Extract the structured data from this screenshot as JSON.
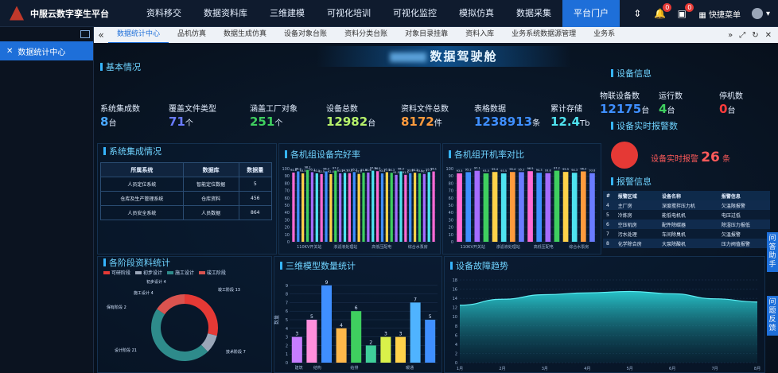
{
  "app": {
    "title": "中服云数字孪生平台"
  },
  "nav": [
    "资料移交",
    "数据资料库",
    "三维建模",
    "可视化培训",
    "可视化监控",
    "模拟仿真",
    "数据采集",
    "平台门户"
  ],
  "nav_active_index": 7,
  "top_right": {
    "badge1": "0",
    "badge2": "0",
    "menu_label": "快捷菜单"
  },
  "sidebar": {
    "items": [
      {
        "label": "数据统计中心"
      }
    ]
  },
  "tabs": [
    "数据统计中心",
    "品机仿真",
    "数据生成仿真",
    "设备对象台账",
    "资料分类台账",
    "对象目录挂靠",
    "资料入库",
    "业务系统数据源管理",
    "业务系"
  ],
  "tabs_active_index": 0,
  "dashboard": {
    "title": "数据驾驶舱",
    "basic_title": "基本情况",
    "basic": [
      {
        "label": "系统集成数",
        "value": "8",
        "unit": "台",
        "color": "#4aa8ff"
      },
      {
        "label": "覆盖文件类型",
        "value": "71",
        "unit": "个",
        "color": "#6a7cff"
      },
      {
        "label": "涵盖工厂对象",
        "value": "251",
        "unit": "个",
        "color": "#3fcf5f"
      },
      {
        "label": "设备总数",
        "value": "12982",
        "unit": "台",
        "color": "#b6f06a"
      },
      {
        "label": "资料文件总数",
        "value": "8172",
        "unit": "件",
        "color": "#ff9b3d"
      },
      {
        "label": "表格数据",
        "value": "1238913",
        "unit": "条",
        "color": "#3f8fff"
      },
      {
        "label": "累计存储",
        "value": "12.4",
        "unit": "Tb",
        "color": "#4fe3f0"
      }
    ],
    "device_info_title": "设备信息",
    "device_info": [
      {
        "label": "物联设备数",
        "value": "12175",
        "unit": "台",
        "color": "#3f8fff"
      },
      {
        "label": "运行数",
        "value": "4",
        "unit": "台",
        "color": "#3fcf5f"
      },
      {
        "label": "停机数",
        "value": "0",
        "unit": "台",
        "color": "#ff3b3b"
      }
    ],
    "realtime_alarm_title": "设备实时报警数",
    "realtime_alarm_label": "设备实时报警",
    "realtime_alarm_value": "26",
    "realtime_alarm_unit": "条",
    "alarm_info_title": "报警信息",
    "alarm_headers": [
      "#",
      "报警区域",
      "设备名称",
      "报警信息"
    ],
    "alarm_rows": [
      [
        "4",
        "主厂房",
        "深度搅拌压力机",
        "欠温限报警"
      ],
      [
        "5",
        "冷炼房",
        "能低电机机",
        "电压过低"
      ],
      [
        "6",
        "空压机房",
        "配件除碳器",
        "除湿压力报低"
      ],
      [
        "7",
        "污水处理",
        "车间除臭机",
        "欠温报警"
      ],
      [
        "8",
        "化学除合房",
        "大泵除酸机",
        "压力阀值报警"
      ]
    ],
    "system_title": "系统集成情况",
    "system_headers": [
      "所属系统",
      "数据库",
      "数据量"
    ],
    "system_rows": [
      [
        "人员定位系统",
        "智能定位数据",
        "5"
      ],
      [
        "仓库及生产管理系统",
        "仓库资料",
        "456"
      ],
      [
        "人员安全系统",
        "人员数据",
        "864"
      ]
    ],
    "stage_title": "各阶段资料统计",
    "stage_legend": [
      "可研阶段",
      "初步设计",
      "施工设计",
      "竣工阶段"
    ],
    "model_title": "三维模型数量统计",
    "fault_title": "设备故障趋势",
    "float_buttons": [
      "问答助手",
      "问题反馈"
    ]
  },
  "chart_data": [
    {
      "type": "bar",
      "title": "各机组设备完好率",
      "ylim": [
        0,
        100
      ],
      "yticks": [
        0,
        10,
        20,
        30,
        40,
        50,
        60,
        70,
        80,
        90,
        100
      ],
      "categories": [
        "110KV开关站",
        "",
        "",
        "",
        "",
        "",
        "",
        "",
        "",
        "",
        "",
        "",
        "",
        "",
        "",
        "",
        "",
        "",
        "",
        "",
        "",
        "",
        "",
        "",
        "",
        "",
        "",
        "",
        "",
        "",
        ""
      ],
      "xlabels": [
        "110KV开关站",
        "渗滤液处理站",
        "高低压配电",
        "综合水泵房"
      ],
      "values": [
        94.6,
        96.2,
        93.5,
        98.2,
        95.1,
        93.5,
        92.5,
        96.2,
        92.4,
        97.2,
        93.5,
        94.1,
        93.8,
        95.3,
        92.8,
        94.4,
        94.6,
        97.2,
        96.5,
        93.4,
        95.1,
        94.3,
        91.5,
        96.3,
        91.5,
        93.8,
        94.3,
        93.5,
        92.7,
        95.3,
        96.1
      ],
      "colors": [
        "#ff6ad5",
        "#3f8fff",
        "#ffd24a",
        "#3fcf5f",
        "#a56cff",
        "#4fe3f0"
      ]
    },
    {
      "type": "bar",
      "title": "各机组开机率对比",
      "ylim": [
        0,
        100
      ],
      "yticks": [
        0,
        10,
        20,
        30,
        40,
        50,
        60,
        70,
        80,
        90,
        100
      ],
      "xlabels": [
        "110KV开关站",
        "渗滤液处理站",
        "高低压配电",
        "综合水泵房"
      ],
      "values": [
        93.5,
        95.2,
        97.1,
        93.5,
        95.4,
        93.5,
        95.4,
        95.2,
        96.5,
        94.3,
        93.8,
        97.2,
        95.5,
        94.3,
        96.2,
        93.8
      ],
      "colors": [
        "#ff6ad5",
        "#3f8fff",
        "#a56cff",
        "#3fcf5f",
        "#ffd24a",
        "#4fe3f0",
        "#ff9b3d",
        "#6a7cff"
      ]
    },
    {
      "type": "pie",
      "title": "各阶段资料统计",
      "slices": [
        {
          "name": "可研阶段",
          "value": 13,
          "color": "#e53935"
        },
        {
          "name": "初步设计",
          "value": 4,
          "color": "#9aa6b8"
        },
        {
          "name": "施工设计",
          "value": 21,
          "color": "#2e8b8b"
        },
        {
          "name": "竣工阶段",
          "value": 7,
          "color": "#d9534f"
        }
      ],
      "labels": [
        "初步设计 4",
        "施工设计 4",
        "保有阶段 2",
        "设计阶段 21",
        "竣工阶段 13",
        "技术阶段 7"
      ]
    },
    {
      "type": "bar",
      "title": "三维模型数量统计",
      "ylabel": "数量",
      "ylim": [
        0,
        10
      ],
      "yticks": [
        0,
        1,
        2,
        3,
        4,
        5,
        6,
        7,
        8,
        9
      ],
      "xlabels": [
        "建筑",
        "结构",
        "",
        "给排",
        "",
        "",
        "暖通",
        ""
      ],
      "values": [
        3,
        5,
        9,
        4,
        6,
        2,
        3,
        3,
        7,
        5
      ],
      "colors": [
        "#c77dff",
        "#ff8fdc",
        "#3f8fff",
        "#ffb84a",
        "#3fcf5f",
        "#3fcf9a",
        "#d9f04a",
        "#ffd24a",
        "#4fb3ff",
        "#3f8fff"
      ]
    },
    {
      "type": "area",
      "title": "设备故障趋势",
      "x": [
        "1月",
        "2月",
        "3月",
        "4月",
        "5月",
        "6月",
        "7月",
        "8月"
      ],
      "values": [
        12.5,
        13.8,
        14.8,
        15.2,
        15.5,
        15.0,
        13.9,
        13.2
      ],
      "ylim": [
        0,
        18
      ],
      "yticks": [
        0,
        2,
        4,
        6,
        8,
        10,
        12,
        14,
        16,
        18
      ]
    }
  ]
}
